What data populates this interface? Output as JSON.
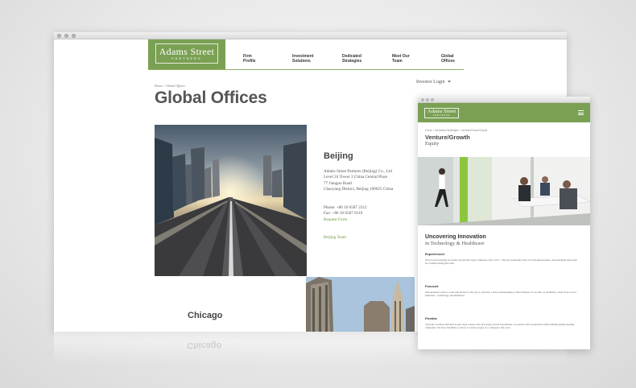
{
  "desktop": {
    "logo": {
      "name": "Adams Street",
      "tagline": "PARTNERS"
    },
    "nav": [
      {
        "line1": "Firm",
        "line2": "Profile"
      },
      {
        "line1": "Investment",
        "line2": "Solutions"
      },
      {
        "line1": "Dedicated",
        "line2": "Strategies"
      },
      {
        "line1": "Meet Our",
        "line2": "Team"
      },
      {
        "line1": "Global",
        "line2": "Offices"
      }
    ],
    "breadcrumb": "Home > Global Offices",
    "investor_login": "Investor Login",
    "page_title": "Global Offices",
    "office": {
      "city": "Beijing",
      "address_lines": [
        "Adams Street Partners (Beijing) Co., Ltd",
        "Level 24 Tower 3 China Central Place",
        "77 Jianguo Road",
        "Chaoyang District, Beijing 100025 China"
      ],
      "phone": "Phone: +86 10 6587 2312",
      "fax": "Fax: +86 10 6587 0110",
      "request_form": "Request Form",
      "team_link": "Beijing Team"
    },
    "next_office": "Chicago"
  },
  "mobile": {
    "logo": {
      "name": "Adams Street",
      "tagline": "PARTNERS"
    },
    "breadcrumb": "Home > Dedicated Strategies > Venture/Growth Equity",
    "title_line1": "Venture/Growth",
    "title_line2": "Equity",
    "heading_line1": "Uncovering Innovation",
    "heading_line2": "in Technology & Healthcare",
    "sections": [
      {
        "title": "Experienced",
        "body": "We've been investing in venture and growth stage companies since 1972 – directly partnering with over 220 entrepreneurs, and managing more than $1.2 billion during that time."
      },
      {
        "title": "Focused",
        "body": "Entrepreneurs want to work with investors who get it, and have a deep understanding of their business. To do this, we maintain a deep focus on two industries – technology and healthcare."
      },
      {
        "title": "Flexible",
        "body": "Typically working with mid-to-late stage venture and early stage growth investments, we partner with exceptional teams building market-leading companies. We have flexibility to invest at various stages of a company's life-cycle."
      }
    ]
  },
  "colors": {
    "brand_green": "#7aa053",
    "link_green": "#6a9a3a"
  }
}
